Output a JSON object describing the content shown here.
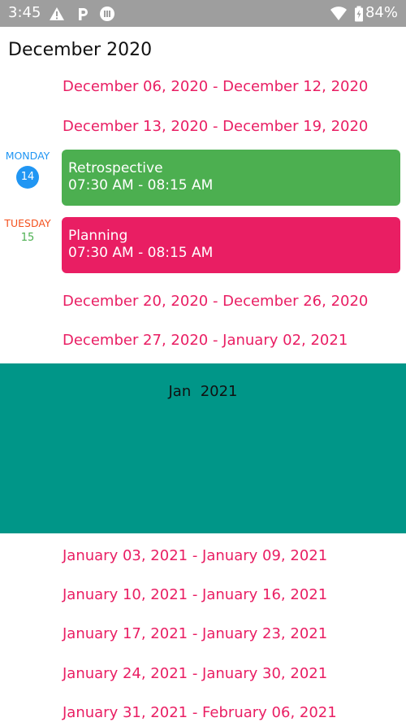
{
  "status_bar": {
    "time": "3:45",
    "battery": "84%",
    "icons": [
      "warning-icon",
      "parking-icon",
      "media-icon",
      "wifi-icon",
      "battery-icon"
    ]
  },
  "colors": {
    "status_bar_bg": "#9e9e9e",
    "range_text": "#e91e63",
    "monday_label": "#2196f3",
    "tuesday_label": "#f4511e",
    "tuesday_number": "#4caf50",
    "retrospective_card": "#4caf50",
    "planning_card": "#e91e63",
    "month_banner": "#009688"
  },
  "schedule": {
    "month_header": "December 2020",
    "weeks_dec": [
      "December 06, 2020 - December 12, 2020",
      "December 13, 2020 - December 19, 2020"
    ],
    "days": [
      {
        "day_name": "MONDAY",
        "day_number": "14",
        "event": {
          "title": "Retrospective",
          "time": "07:30 AM - 08:15 AM"
        }
      },
      {
        "day_name": "TUESDAY",
        "day_number": "15",
        "event": {
          "title": "Planning",
          "time": "07:30 AM - 08:15 AM"
        }
      }
    ],
    "weeks_dec_late": [
      "December 20, 2020 - December 26, 2020",
      "December 27, 2020 - January 02, 2021"
    ],
    "month_banner": "Jan  2021",
    "weeks_jan": [
      "January 03, 2021 - January 09, 2021",
      "January 10, 2021 - January 16, 2021",
      "January 17, 2021 - January 23, 2021",
      "January 24, 2021 - January 30, 2021",
      "January 31, 2021 - February 06, 2021"
    ]
  }
}
